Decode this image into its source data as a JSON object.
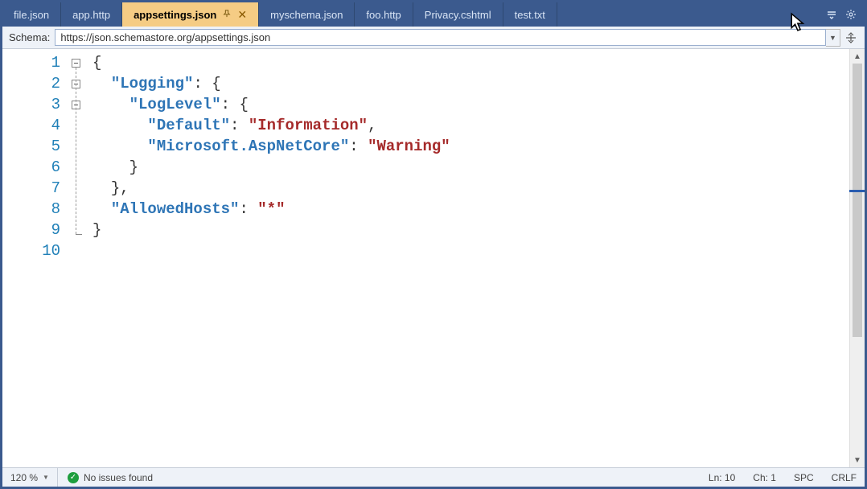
{
  "tabs": [
    {
      "label": "file.json"
    },
    {
      "label": "app.http"
    },
    {
      "label": "appsettings.json",
      "active": true
    },
    {
      "label": "myschema.json"
    },
    {
      "label": "foo.http"
    },
    {
      "label": "Privacy.cshtml"
    },
    {
      "label": "test.txt"
    }
  ],
  "schema": {
    "label": "Schema:",
    "value": "https://json.schemastore.org/appsettings.json"
  },
  "lineNumbers": [
    "1",
    "2",
    "3",
    "4",
    "5",
    "6",
    "7",
    "8",
    "9",
    "10"
  ],
  "code": {
    "l1_brace_open": "{",
    "l2_key": "\"Logging\"",
    "l2_brace": "{",
    "l3_key": "\"LogLevel\"",
    "l3_brace": "{",
    "l4_key": "\"Default\"",
    "l4_val": "\"Information\"",
    "l5_key": "\"Microsoft.AspNetCore\"",
    "l5_val": "\"Warning\"",
    "l6_brace_close": "}",
    "l7_brace_close": "}",
    "l7_comma": ",",
    "l8_key": "\"AllowedHosts\"",
    "l8_val": "\"*\"",
    "l9_brace_close": "}",
    "colon": ":",
    "comma": ","
  },
  "status": {
    "zoom": "120 %",
    "issues": "No issues found",
    "line": "Ln: 10",
    "col": "Ch: 1",
    "indent": "SPC",
    "eol": "CRLF"
  }
}
